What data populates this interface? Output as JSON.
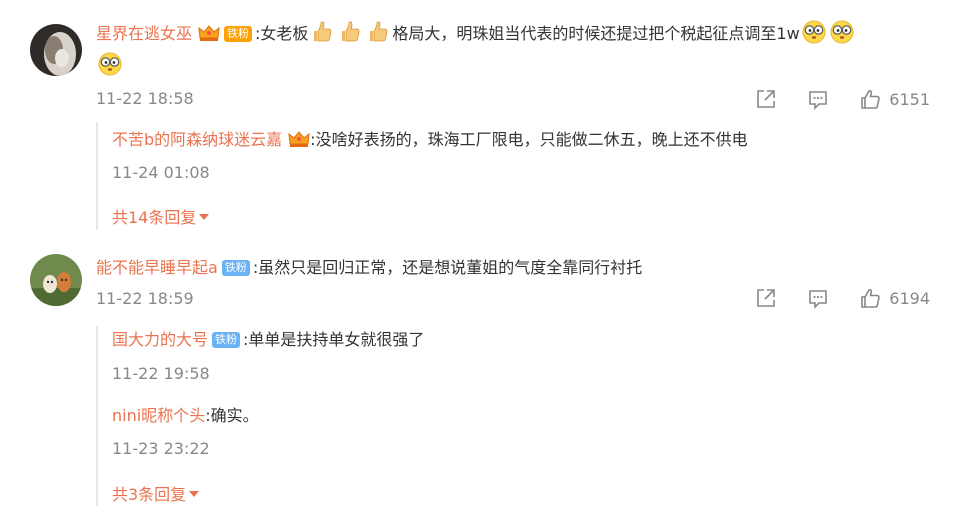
{
  "comments": [
    {
      "username": "星界在逃女巫",
      "badge": "铁粉",
      "text_part1": ":女老板",
      "text_part2": "格局大，明珠姐当代表的时候还提过把个税起征点调至1w",
      "timestamp": "11-22 18:58",
      "likes": "6151",
      "replies": [
        {
          "username": "不苦b的阿森纳球迷云嘉",
          "text": ":没啥好表扬的，珠海工厂限电，只能做二休五，晚上还不供电",
          "timestamp": "11-24 01:08"
        }
      ],
      "more_replies": "共14条回复"
    },
    {
      "username": "能不能早睡早起a",
      "badge": "铁粉",
      "text": ":虽然只是回归正常，还是想说董姐的气度全靠同行衬托",
      "timestamp": "11-22 18:59",
      "likes": "6194",
      "replies": [
        {
          "username": "国大力的大号",
          "badge": "铁粉",
          "text": ":单单是扶持单女就很强了",
          "timestamp": "11-22 19:58"
        },
        {
          "username": "nini昵称个头",
          "text": ":确实。",
          "timestamp": "11-23 23:22"
        }
      ],
      "more_replies": "共3条回复"
    }
  ],
  "icons": {
    "share": "share-icon",
    "comment": "comment-icon",
    "like": "thumbs-up-icon",
    "crown": "crown-icon",
    "thumbs_emoji": "thumbs-up-emoji",
    "eyes_emoji": "surprised-glasses-emoji"
  },
  "colors": {
    "username": "#eb7350",
    "timestamp": "#888888",
    "badge_gold": "#ffa100",
    "badge_blue": "#6ab1f5"
  }
}
